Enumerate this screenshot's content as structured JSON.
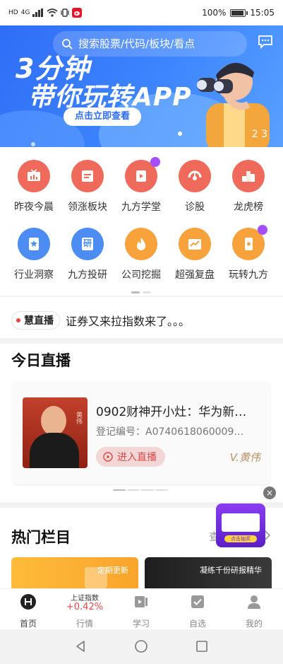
{
  "status_bar": {
    "left_glyph": "HD",
    "network_label": "4G",
    "battery": "100%",
    "time": "15:05"
  },
  "banner": {
    "search_placeholder": "搜索股票/代码/板块/看点",
    "headline_1": "3分钟",
    "headline_2": "带你玩转APP",
    "cta": "点击立即查看",
    "page_indicator": "2 3"
  },
  "quick_grid": {
    "row1": [
      {
        "label": "昨夜今晨",
        "color": "#ef6a5b"
      },
      {
        "label": "领涨板块",
        "color": "#ef6a5b"
      },
      {
        "label": "九方学堂",
        "color": "#ef6a5b"
      },
      {
        "label": "诊股",
        "color": "#ef6a5b"
      },
      {
        "label": "龙虎榜",
        "color": "#ef6a5b"
      }
    ],
    "row2": [
      {
        "label": "行业洞察",
        "color": "#4b8df2"
      },
      {
        "label": "九方投研",
        "color": "#4b8df2"
      },
      {
        "label": "公司挖掘",
        "color": "#f7a23a"
      },
      {
        "label": "超强复盘",
        "color": "#f7a23a"
      },
      {
        "label": "玩转九方",
        "color": "#f7a23a"
      }
    ],
    "research_glyph": "研"
  },
  "live_ticker": {
    "tag": "慧直播",
    "text": "证券又来拉指数来了。。。"
  },
  "today_live": {
    "title": "今日直播",
    "card": {
      "photo_tag": "黄伟",
      "title": "0902财神开小灶：华为新…",
      "registration": "登记编号：A0740618060009…",
      "enter_button": "进入直播",
      "signature": "V.黄伟"
    }
  },
  "hot_columns": {
    "title": "热门栏目",
    "more": "查",
    "close": "×",
    "ad_label": "点击抽奖",
    "cards": [
      {
        "text": "定期更新"
      },
      {
        "text": "凝练千份研报精华"
      }
    ]
  },
  "tab_bar": {
    "tabs": [
      {
        "label": "首页"
      },
      {
        "label": "行情"
      },
      {
        "label": "学习"
      },
      {
        "label": "自选"
      },
      {
        "label": "我的"
      }
    ],
    "index_name": "上证指数",
    "index_change": "+0.42%"
  },
  "colors": {
    "accent_red": "#e54848",
    "banner_blue": "#2f6df6",
    "brand_purple": "#a64dff"
  }
}
